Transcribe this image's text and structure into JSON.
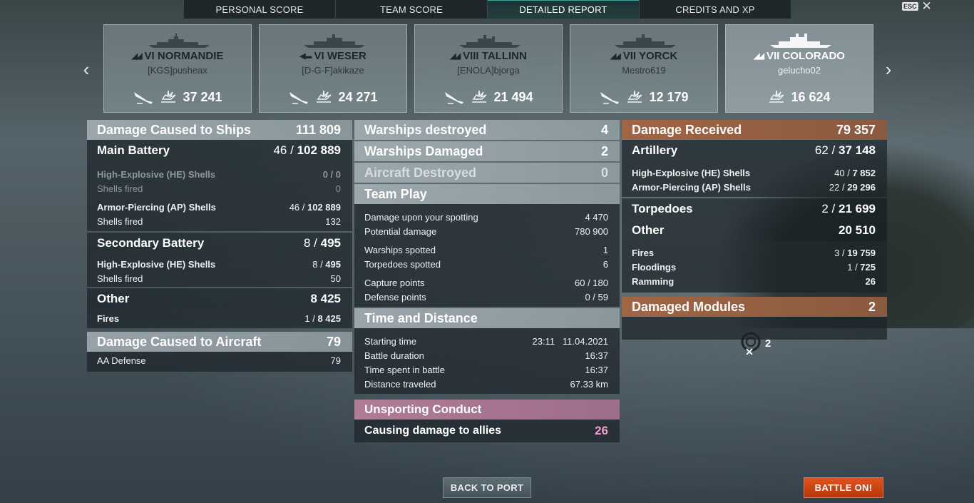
{
  "tabs": [
    "PERSONAL SCORE",
    "TEAM SCORE",
    "DETAILED REPORT",
    "CREDITS AND XP"
  ],
  "esc": {
    "key": "ESC",
    "close": "✕"
  },
  "nav": {
    "prev": "‹",
    "next": "›"
  },
  "ships": [
    {
      "name": "VI NORMANDIE",
      "player": "[KGS]pusheax",
      "damage": "37 241",
      "icons": [
        "sunk-ship-icon",
        "damage-burst-icon"
      ]
    },
    {
      "name": "VI WESER",
      "player": "[D-G-F]akikaze",
      "damage": "24 271",
      "icons": [
        "sunk-ship-icon",
        "damage-burst-icon"
      ]
    },
    {
      "name": "VIII TALLINN",
      "player": "[ENOLA]bjorga",
      "damage": "21 494",
      "icons": [
        "sunk-ship-icon",
        "damage-burst-icon"
      ]
    },
    {
      "name": "VII YORCK",
      "player": "Mestro619",
      "damage": "12 179",
      "icons": [
        "sunk-ship-icon",
        "damage-burst-icon"
      ]
    },
    {
      "name": "VII COLORADO",
      "player": "gelucho02",
      "damage": "16 624",
      "icons": [
        "damage-burst-icon"
      ]
    }
  ],
  "left": {
    "dmg_ships": {
      "label": "Damage Caused to Ships",
      "value": "111 809"
    },
    "main_battery": {
      "label": "Main Battery",
      "hits": "46",
      "value": "102 889"
    },
    "he": {
      "label": "High-Explosive (HE) Shells",
      "hits": "0",
      "value": "0",
      "fired_label": "Shells fired",
      "fired": "0"
    },
    "ap": {
      "label": "Armor-Piercing (AP) Shells",
      "hits": "46",
      "value": "102 889",
      "fired_label": "Shells fired",
      "fired": "132"
    },
    "secondary": {
      "label": "Secondary Battery",
      "hits": "8",
      "value": "495"
    },
    "sec_he": {
      "label": "High-Explosive (HE) Shells",
      "hits": "8",
      "value": "495",
      "fired_label": "Shells fired",
      "fired": "50"
    },
    "other": {
      "label": "Other",
      "value": "8 425"
    },
    "fires": {
      "label": "Fires",
      "hits": "1",
      "value": "8 425"
    },
    "dmg_air": {
      "label": "Damage Caused to Aircraft",
      "value": "79"
    },
    "aa": {
      "label": "AA Defense",
      "value": "79"
    }
  },
  "mid": {
    "destroyed": {
      "label": "Warships destroyed",
      "value": "4"
    },
    "damaged": {
      "label": "Warships Damaged",
      "value": "2"
    },
    "aircraft": {
      "label": "Aircraft Destroyed",
      "value": "0"
    },
    "teamplay": {
      "label": "Team Play"
    },
    "spot_dmg": {
      "label": "Damage upon your spotting",
      "value": "4 470"
    },
    "potential": {
      "label": "Potential damage",
      "value": "780 900"
    },
    "ws_spotted": {
      "label": "Warships spotted",
      "value": "1"
    },
    "torp_spotted": {
      "label": "Torpedoes spotted",
      "value": "6"
    },
    "capture": {
      "label": "Capture points",
      "value": "60 / 180"
    },
    "defense": {
      "label": "Defense points",
      "value": "0 / 59"
    },
    "time": {
      "label": "Time and Distance"
    },
    "start": {
      "label": "Starting time",
      "value": "23:11   11.04.2021"
    },
    "duration": {
      "label": "Battle duration",
      "value": "16:37"
    },
    "spent": {
      "label": "Time spent in battle",
      "value": "16:37"
    },
    "distance": {
      "label": "Distance traveled",
      "value": "67.33 km"
    },
    "unsporting": {
      "label": "Unsporting Conduct"
    },
    "allies": {
      "label": "Causing damage to allies",
      "value": "26"
    }
  },
  "right": {
    "received": {
      "label": "Damage Received",
      "value": "79 357"
    },
    "artillery": {
      "label": "Artillery",
      "hits": "62",
      "value": "37 148"
    },
    "r_he": {
      "label": "High-Explosive (HE) Shells",
      "hits": "40",
      "value": "7 852"
    },
    "r_ap": {
      "label": "Armor-Piercing (AP) Shells",
      "hits": "22",
      "value": "29 296"
    },
    "torpedoes": {
      "label": "Torpedoes",
      "hits": "2",
      "value": "21 699"
    },
    "other": {
      "label": "Other",
      "value": "20 510"
    },
    "fires": {
      "label": "Fires",
      "hits": "3",
      "value": "19 759"
    },
    "floodings": {
      "label": "Floodings",
      "hits": "1",
      "value": "725"
    },
    "ramming": {
      "label": "Ramming",
      "value": "26"
    },
    "modules": {
      "label": "Damaged Modules",
      "value": "2"
    },
    "module_count": "2"
  },
  "buttons": {
    "back": "BACK TO PORT",
    "battle": "BATTLE ON!"
  },
  "colors": {
    "accent_received": "#a16644",
    "unsporting": "#b07c98",
    "battle_btn": "#d4461a",
    "pink_value": "#f29bd2"
  }
}
